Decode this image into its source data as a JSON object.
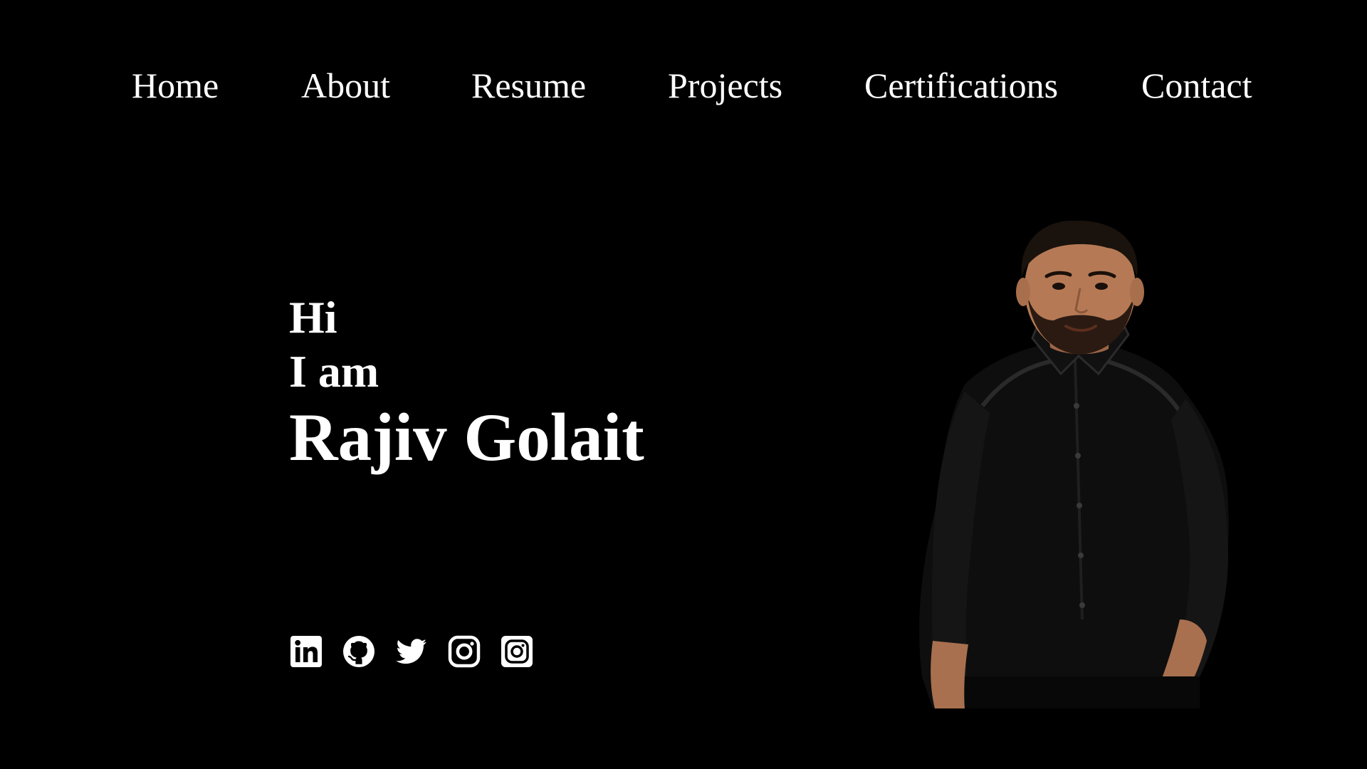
{
  "nav": {
    "items": [
      {
        "label": "Home"
      },
      {
        "label": "About"
      },
      {
        "label": "Resume"
      },
      {
        "label": "Projects"
      },
      {
        "label": "Certifications"
      },
      {
        "label": "Contact"
      }
    ]
  },
  "hero": {
    "greeting": "Hi",
    "intro": "I am",
    "name": "Rajiv Golait"
  },
  "socials": [
    {
      "icon": "linkedin-icon"
    },
    {
      "icon": "github-icon"
    },
    {
      "icon": "twitter-icon"
    },
    {
      "icon": "instagram-icon"
    },
    {
      "icon": "instagram-icon"
    }
  ],
  "colors": {
    "background": "#000000",
    "text": "#ffffff"
  }
}
